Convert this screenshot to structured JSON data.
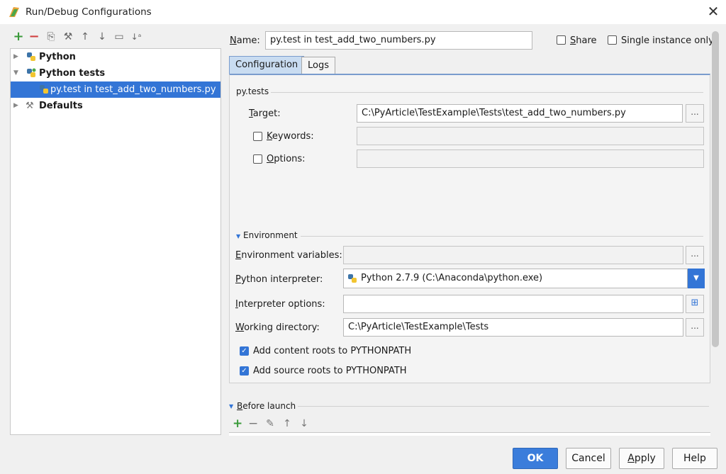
{
  "window": {
    "title": "Run/Debug Configurations",
    "close_glyph": "✕"
  },
  "left_toolbar": {
    "buttons": [
      {
        "icon": "plus-icon",
        "glyph": "+"
      },
      {
        "icon": "minus-icon",
        "glyph": "−"
      },
      {
        "icon": "copy-icon",
        "glyph": "⎘"
      },
      {
        "icon": "wrench-icon",
        "glyph": "⚒"
      },
      {
        "icon": "arrow-up-icon",
        "glyph": "↑"
      },
      {
        "icon": "arrow-down-icon",
        "glyph": "↓"
      },
      {
        "icon": "folder-icon",
        "glyph": "▭"
      },
      {
        "icon": "sort-icon",
        "glyph": "↓ᵃ"
      }
    ]
  },
  "tree": {
    "items": [
      {
        "label": "Python",
        "bold": true,
        "expanded": false
      },
      {
        "label": "Python tests",
        "bold": true,
        "expanded": true
      },
      {
        "label": "py.test in test_add_two_numbers.py",
        "bold": false,
        "selected": true
      },
      {
        "label": "Defaults",
        "bold": true,
        "expanded": false
      }
    ]
  },
  "header": {
    "name_label": "Name:",
    "name_value": "py.test in test_add_two_numbers.py",
    "share_label": "Share",
    "single_instance_label": "Single instance only"
  },
  "tabs": [
    {
      "label": "Configuration",
      "active": true
    },
    {
      "label": "Logs",
      "active": false
    }
  ],
  "config": {
    "section_title": "py.tests",
    "target_label": "Target:",
    "target_value": "C:\\PyArticle\\TestExample\\Tests\\test_add_two_numbers.py",
    "keywords_label": "Keywords:",
    "keywords_value": "",
    "options_label": "Options:",
    "options_value": "",
    "browse_glyph": "..."
  },
  "environment": {
    "section_title": "Environment",
    "env_vars_label": "Environment variables:",
    "env_vars_value": "",
    "interpreter_label": "Python interpreter:",
    "interpreter_value": "Python 2.7.9 (C:\\Anaconda\\python.exe)",
    "interp_options_label": "Interpreter options:",
    "interp_options_value": "",
    "working_dir_label": "Working directory:",
    "working_dir_value": "C:\\PyArticle\\TestExample\\Tests",
    "content_roots_label": "Add content roots to PYTHONPATH",
    "content_roots_checked": true,
    "source_roots_label": "Add source roots to PYTHONPATH",
    "source_roots_checked": true
  },
  "before_launch": {
    "title": "Before launch",
    "icons": [
      {
        "icon": "plus-icon",
        "glyph": "+"
      },
      {
        "icon": "minus-icon",
        "glyph": "−"
      },
      {
        "icon": "pencil-icon",
        "glyph": "✎"
      },
      {
        "icon": "arrow-up-icon",
        "glyph": "↑"
      },
      {
        "icon": "arrow-down-icon",
        "glyph": "↓"
      }
    ]
  },
  "footer": {
    "ok_label": "OK",
    "cancel_label": "Cancel",
    "apply_label": "Apply",
    "help_label": "Help"
  },
  "colors": {
    "accent": "#3375d6",
    "add_green": "#3a9a3a",
    "remove_red": "#d04040"
  }
}
